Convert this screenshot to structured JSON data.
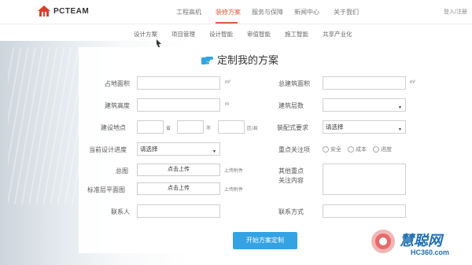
{
  "header": {
    "logo_text": "PCTEAM",
    "nav": [
      "工程高机",
      "装修方案",
      "服务与保障",
      "新闻中心",
      "关于我们"
    ],
    "active_nav_index": 1,
    "login": "登入/注册"
  },
  "subnav": [
    "设计方案",
    "项目管理",
    "设计智能",
    "审值智能",
    "施工智能",
    "共享产业化"
  ],
  "title": "定制我的方案",
  "form": {
    "area_label": "占地面积",
    "area_unit": "m²",
    "total_area_label": "总建筑面积",
    "total_area_unit": "m²",
    "height_label": "建筑高度",
    "height_unit": "m",
    "floors_label": "建筑层数",
    "location_label": "建设地点",
    "province_unit": "省",
    "city_unit": "市",
    "district_unit": "区/县",
    "equipment_label": "装配式要求",
    "equipment_value": "请选择",
    "stage_label": "当前设计进度",
    "stage_value": "请选择",
    "focus_label": "重点关注项",
    "focus_options": [
      "安全",
      "成本",
      "进度"
    ],
    "drawing_label": "总图",
    "drawing_button": "点击上传",
    "drawing_note": "上传附件",
    "standard_label": "标准层平面图",
    "standard_button": "点击上传",
    "standard_note": "上传附件",
    "other_label_1": "其他重点",
    "other_label_2": "关注内容",
    "contact_label": "联系人",
    "contact_method_label": "联系方式"
  },
  "submit_label": "开始方案定制",
  "watermark": {
    "text": "慧聪网",
    "url": "HC360.com"
  },
  "colors": {
    "accent": "#e25b3c",
    "button": "#34a3e3",
    "watermark": "#1f6fb3"
  }
}
